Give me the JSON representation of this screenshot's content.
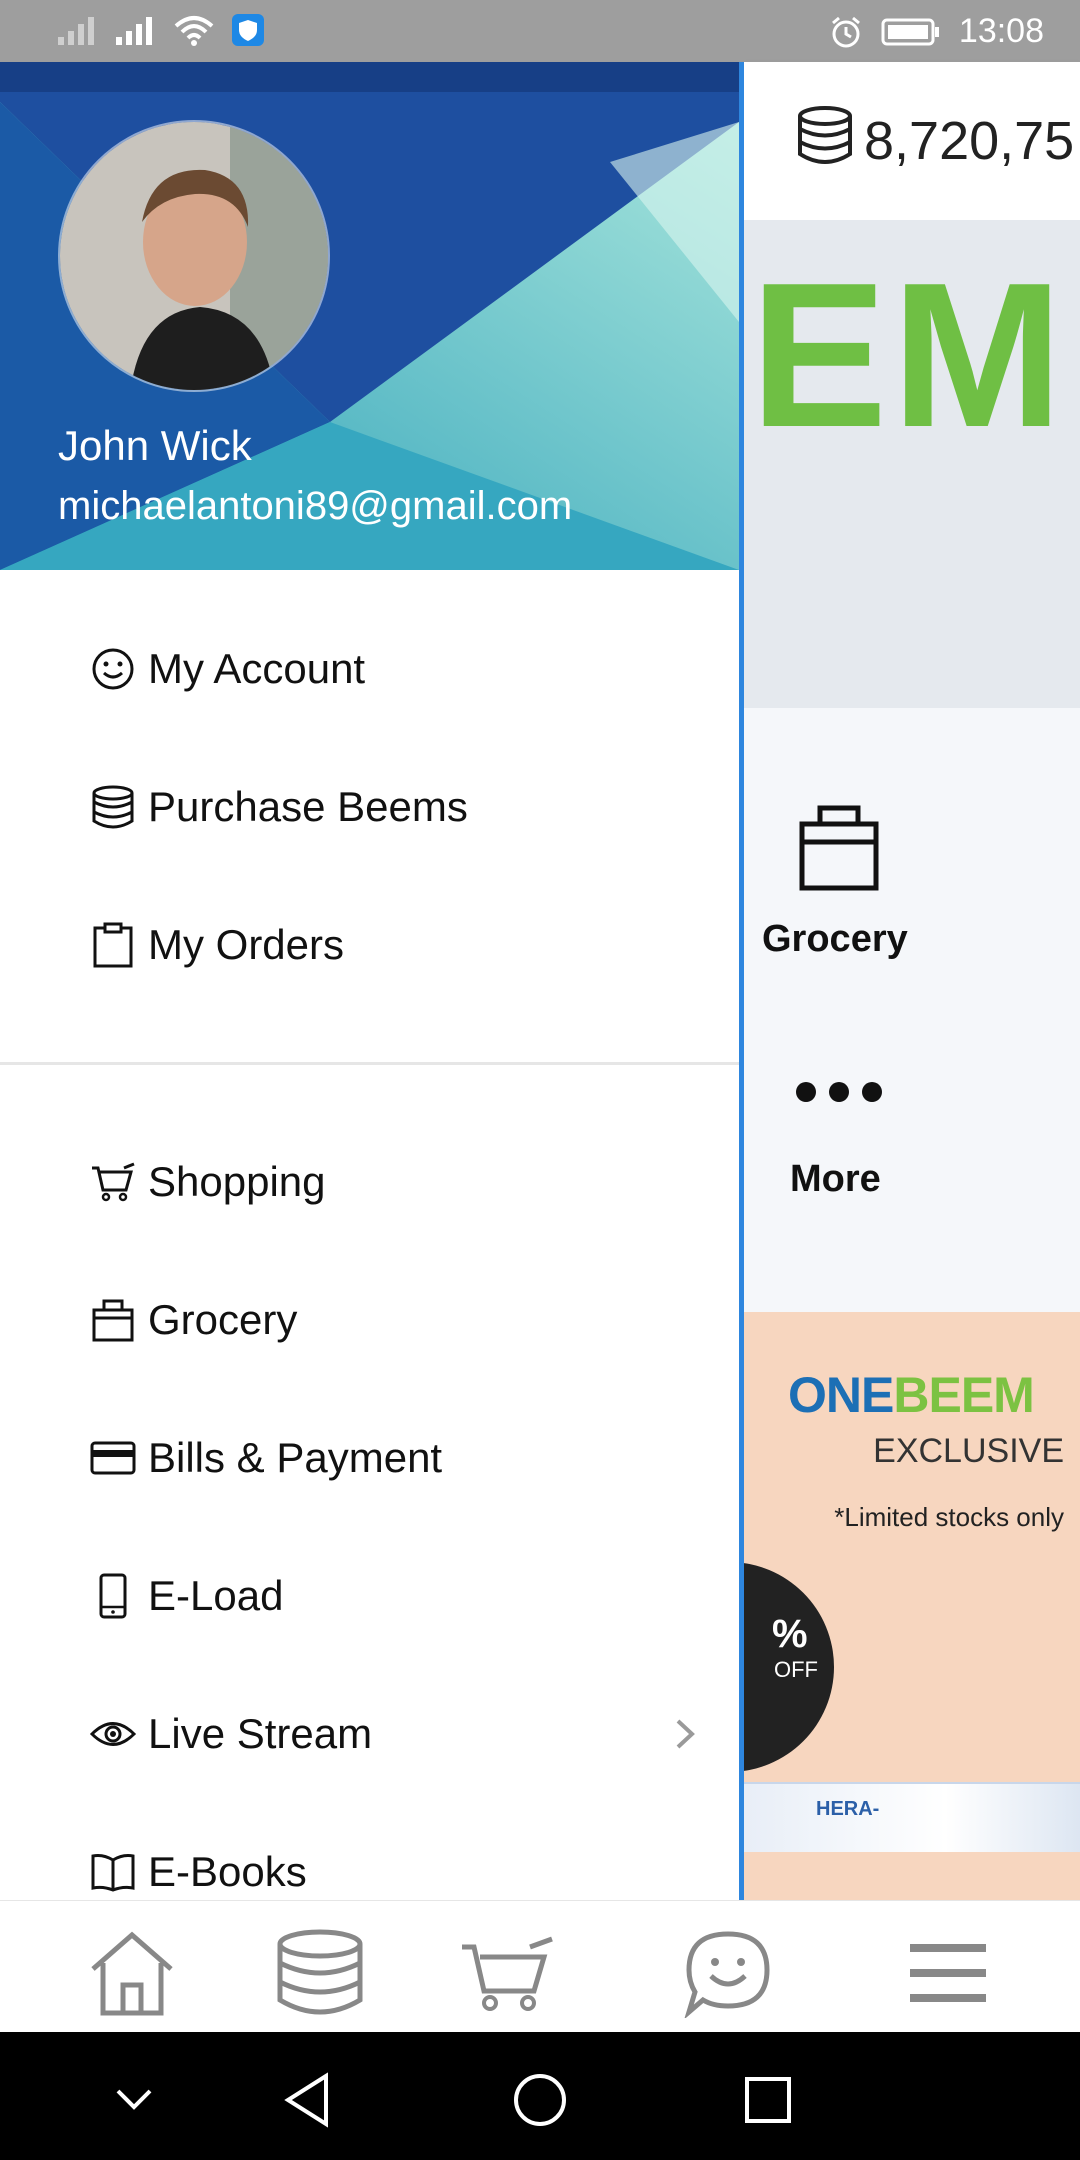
{
  "status_bar": {
    "time": "13:08"
  },
  "background": {
    "balance": "8,720,75",
    "brand_partial": "EM",
    "categories": [
      {
        "label": "Grocery",
        "icon": "shopping-bag-icon"
      },
      {
        "label": "More",
        "icon": "more-dots-icon"
      }
    ],
    "promo": {
      "brand_a": "ONE",
      "brand_b": "BEEM",
      "exclusive": "EXCLUSIVE",
      "limited": "*Limited stocks only",
      "percent": "%",
      "off": "OFF",
      "product": "HERA-"
    }
  },
  "drawer": {
    "user_name": "John Wick",
    "user_email": "michaelantoni89@gmail.com",
    "account_items": [
      {
        "label": "My Account",
        "icon": "smiley-icon"
      },
      {
        "label": "Purchase Beems",
        "icon": "coins-icon"
      },
      {
        "label": "My Orders",
        "icon": "clipboard-icon"
      }
    ],
    "service_items": [
      {
        "label": "Shopping",
        "icon": "cart-icon"
      },
      {
        "label": "Grocery",
        "icon": "shopping-bag-icon"
      },
      {
        "label": "Bills & Payment",
        "icon": "credit-card-icon"
      },
      {
        "label": "E-Load",
        "icon": "phone-icon"
      },
      {
        "label": "Live Stream",
        "icon": "eye-icon",
        "has_submenu": true
      },
      {
        "label": "E-Books",
        "icon": "book-icon"
      }
    ]
  },
  "bottom_nav": [
    {
      "name": "home",
      "icon": "home-icon"
    },
    {
      "name": "beems",
      "icon": "coins-icon"
    },
    {
      "name": "cart",
      "icon": "cart-icon"
    },
    {
      "name": "chat",
      "icon": "chat-smiley-icon"
    },
    {
      "name": "menu",
      "icon": "hamburger-menu-icon"
    }
  ],
  "colors": {
    "drawer_accent": "#2e86de",
    "brand_green": "#6fbf44",
    "brand_blue": "#1c6fb5",
    "header_dark": "#1a3f8e",
    "header_teal": "#5ec7c4"
  }
}
